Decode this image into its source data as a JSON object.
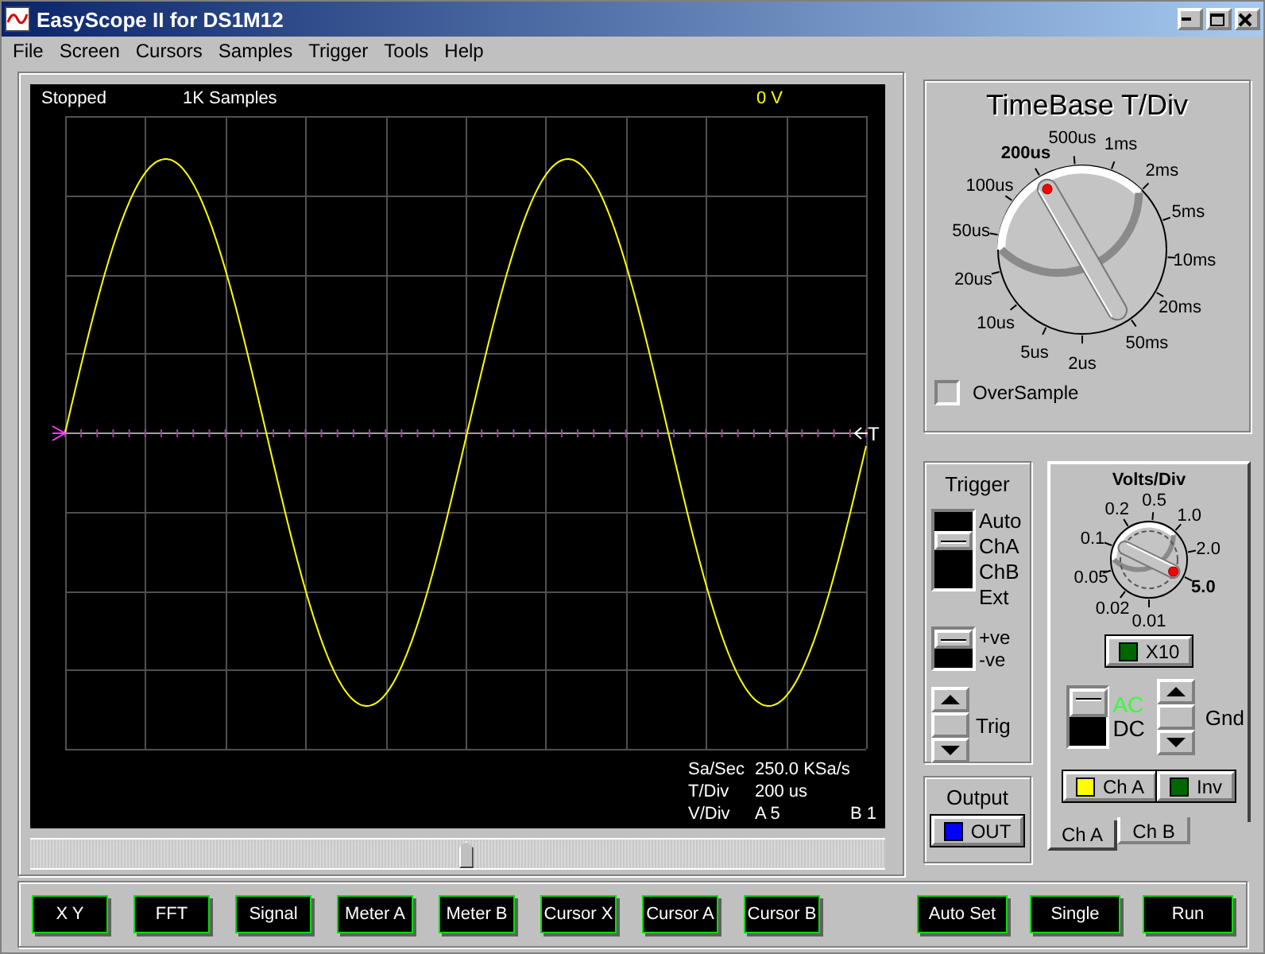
{
  "window": {
    "title": "EasyScope II for DS1M12"
  },
  "menu": [
    {
      "label": "File"
    },
    {
      "label": "Screen"
    },
    {
      "label": "Cursors"
    },
    {
      "label": "Samples"
    },
    {
      "label": "Trigger"
    },
    {
      "label": "Tools"
    },
    {
      "label": "Help"
    }
  ],
  "scope": {
    "status": "Stopped",
    "samples": "1K Samples",
    "trigger_level": "0 V",
    "trigger_marker": "T",
    "readouts": [
      {
        "label": "Sa/Sec",
        "value": "250.0 KSa/s"
      },
      {
        "label": "T/Div",
        "value": "200 us"
      },
      {
        "label": "V/Div",
        "value": "A 5",
        "value_2": "B 1"
      }
    ]
  },
  "position_slider": {
    "level": 0.51
  },
  "timebase": {
    "title": "TimeBase T/Div",
    "dial": [
      {
        "label": "2us",
        "selected": false
      },
      {
        "label": "5us",
        "selected": false
      },
      {
        "label": "10us",
        "selected": false
      },
      {
        "label": "20us",
        "selected": false
      },
      {
        "label": "50us",
        "selected": false
      },
      {
        "label": "100us",
        "selected": false
      },
      {
        "label": "200us",
        "selected": true
      },
      {
        "label": "500us",
        "selected": false
      },
      {
        "label": "1ms",
        "selected": false
      },
      {
        "label": "2ms",
        "selected": false
      },
      {
        "label": "5ms",
        "selected": false
      },
      {
        "label": "10ms",
        "selected": false
      },
      {
        "label": "20ms",
        "selected": false
      },
      {
        "label": "50ms",
        "selected": false
      }
    ],
    "oversample": {
      "label": "OverSample",
      "checked": false
    }
  },
  "trigger": {
    "title": "Trigger",
    "source": [
      {
        "label": "Auto",
        "selected": false
      },
      {
        "label": "ChA",
        "selected": true
      },
      {
        "label": "ChB",
        "selected": false
      },
      {
        "label": "Ext",
        "selected": false
      }
    ],
    "slope": [
      {
        "label": "+ve",
        "selected": true
      },
      {
        "label": "-ve",
        "selected": false
      }
    ],
    "level_label": "Trig"
  },
  "output": {
    "title": "Output",
    "button": {
      "label": "OUT",
      "color": "#0000ff"
    }
  },
  "volts": {
    "title": "Volts/Div",
    "dial": [
      {
        "label": "0.01",
        "selected": false
      },
      {
        "label": "0.02",
        "selected": false
      },
      {
        "label": "0.05",
        "selected": false
      },
      {
        "label": "0.1",
        "selected": false
      },
      {
        "label": "0.2",
        "selected": false
      },
      {
        "label": "0.5",
        "selected": false
      },
      {
        "label": "1.0",
        "selected": false
      },
      {
        "label": "2.0",
        "selected": false
      },
      {
        "label": "5.0",
        "selected": true
      }
    ],
    "x10": {
      "label": "X10",
      "color": "#006600"
    },
    "coupling": [
      {
        "label": "AC",
        "selected": true
      },
      {
        "label": "DC",
        "selected": false
      }
    ],
    "offset_label": "Gnd",
    "channel_button": {
      "label": "Ch A",
      "color": "#ffff00"
    },
    "invert_button": {
      "label": "Inv",
      "color": "#006600"
    }
  },
  "channel_tabs": [
    {
      "label": "Ch A",
      "selected": true
    },
    {
      "label": "Ch B",
      "selected": false
    }
  ],
  "toolbar_left": [
    "X Y",
    "FFT",
    "Signal",
    "Meter A",
    "Meter B",
    "Cursor X",
    "Cursor A",
    "Cursor B"
  ],
  "toolbar_right": [
    "Auto Set",
    "Single",
    "Run"
  ]
}
